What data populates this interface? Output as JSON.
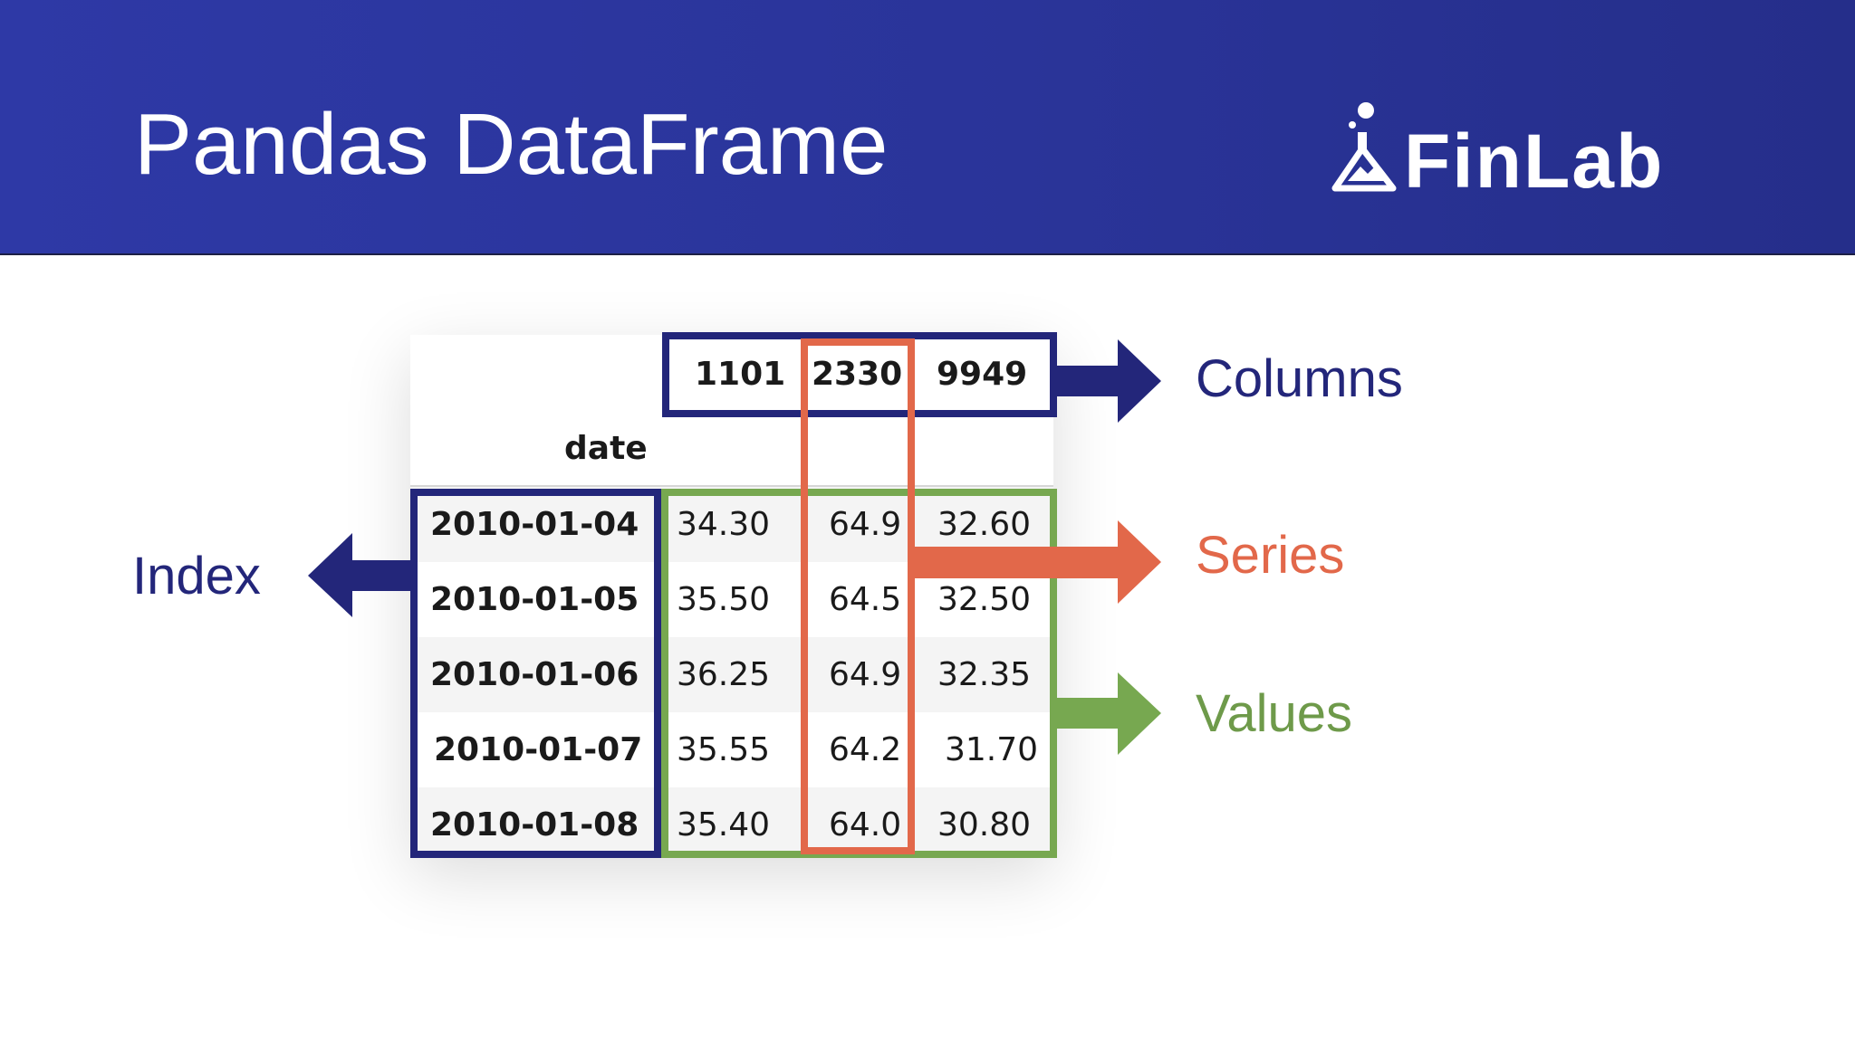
{
  "header": {
    "title": "Pandas DataFrame"
  },
  "logo": {
    "text": "FinLab"
  },
  "table": {
    "index_name": "date",
    "columns": [
      "1101",
      "2330",
      "9949"
    ],
    "rows": [
      {
        "index": "2010-01-04",
        "values": [
          "34.30",
          "64.9",
          "32.60"
        ]
      },
      {
        "index": "2010-01-05",
        "values": [
          "35.50",
          "64.5",
          "32.50"
        ]
      },
      {
        "index": "2010-01-06",
        "values": [
          "36.25",
          "64.9",
          "32.35"
        ]
      },
      {
        "index": "2010-01-07",
        "values": [
          "35.55",
          "64.2",
          "31.70"
        ]
      },
      {
        "index": "2010-01-08",
        "values": [
          "35.40",
          "64.0",
          "30.80"
        ]
      }
    ]
  },
  "annotations": {
    "columns": "Columns",
    "series": "Series",
    "values": "Values",
    "index": "Index"
  },
  "colors": {
    "header_bg": "#2a3499",
    "columns_box": "#23267a",
    "index_box": "#23267a",
    "values_box": "#77a850",
    "series_box": "#e2684a",
    "columns_label": "#23267a",
    "index_label": "#23267a",
    "series_label": "#e2684a",
    "values_label": "#6e9a4a"
  }
}
